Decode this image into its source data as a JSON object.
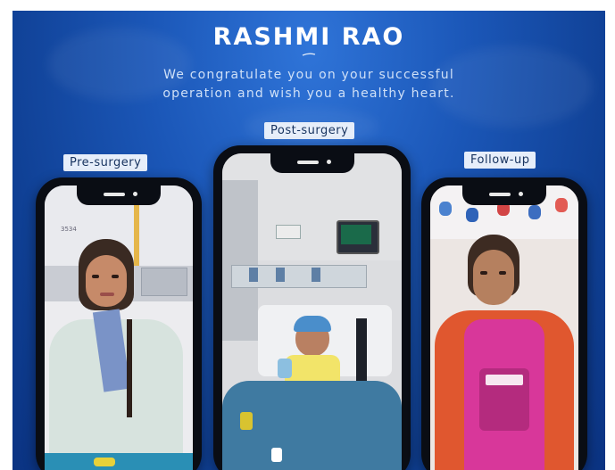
{
  "header": {
    "name": "RASHMI RAO",
    "message_line1": "We congratulate you on your successful",
    "message_line2": "operation and wish you a healthy heart."
  },
  "stages": {
    "pre": "Pre-surgery",
    "post": "Post-surgery",
    "follow": "Follow-up"
  },
  "photo_text": {
    "room_sign": "3534"
  },
  "colors": {
    "background": "#1b57b8",
    "label_bg": "#e6eefa",
    "label_text": "#17335f",
    "phone": "#0a0d14"
  }
}
